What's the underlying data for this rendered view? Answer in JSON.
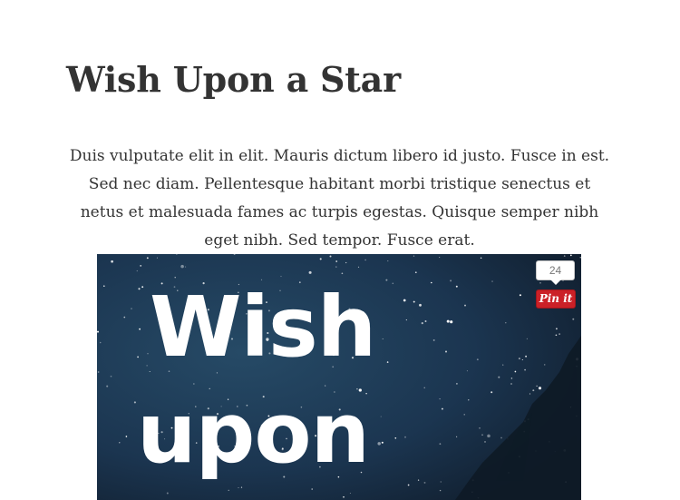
{
  "post": {
    "title": "Wish Upon a Star",
    "body": "Duis vulputate elit in elit. Mauris dictum libero id justo. Fusce in est. Sed nec diam. Pellentesque habitant morbi tristique senectus et netus et malesuada fames ac turpis egestas. Quisque semper nibh eget nibh. Sed tempor. Fusce erat."
  },
  "featured_image": {
    "text_line1": "Wish",
    "text_line2": "upon",
    "sky_color": "#1b2f44"
  },
  "pinterest": {
    "count": "24",
    "button_label": "Pin it",
    "brand_color": "#cb2027"
  }
}
